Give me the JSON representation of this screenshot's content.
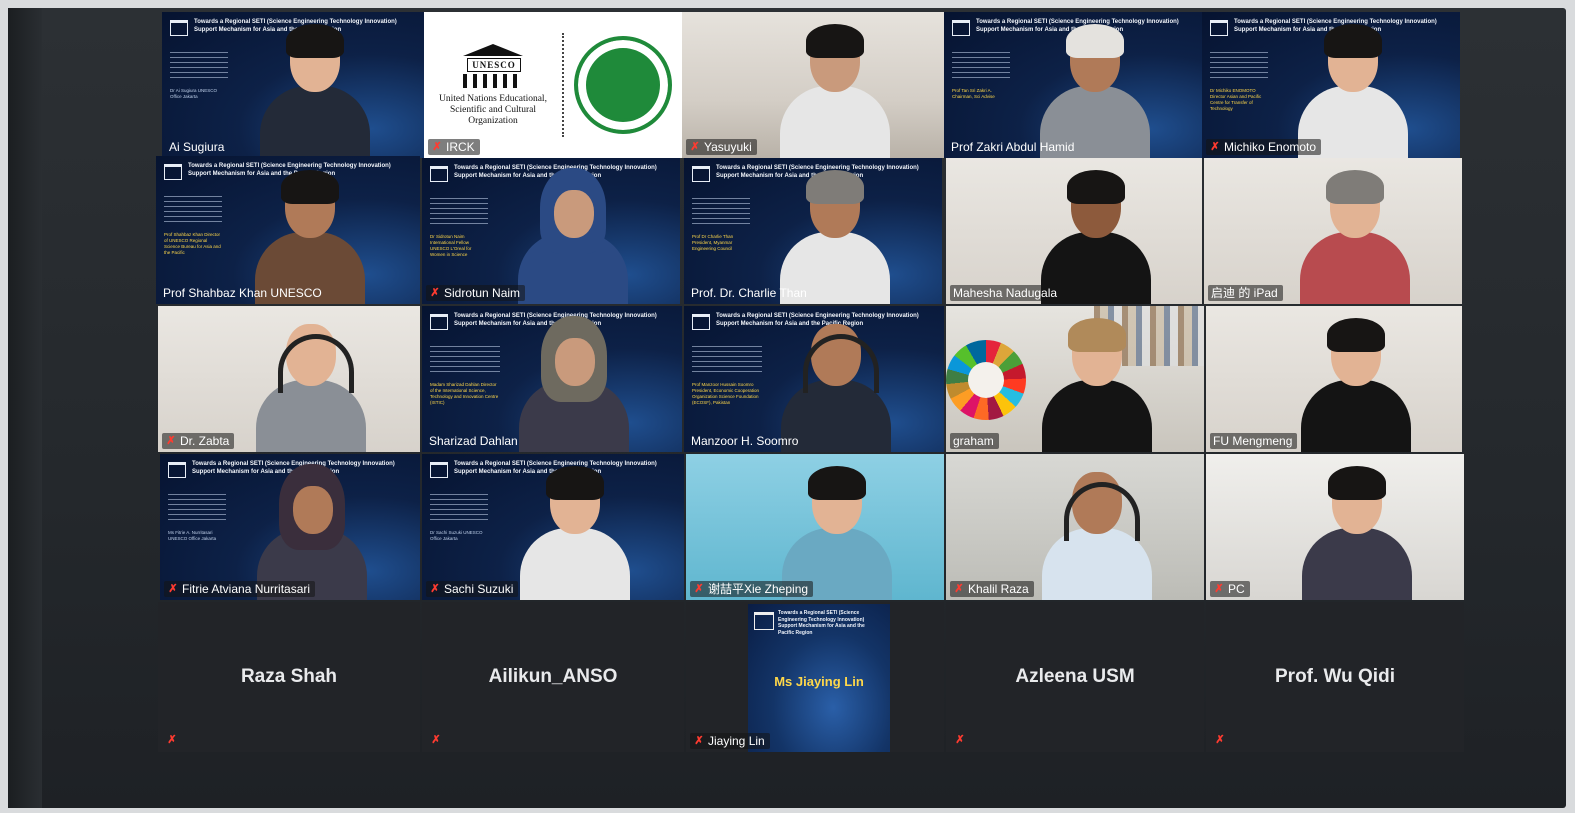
{
  "meeting": {
    "slide_title": "Towards a Regional SETI (Science Engineering Technology Innovation) Support Mechanism for Asia and the Pacific Region",
    "slide_subtitle": "Experts Dialogue on SETI Priorities and Implementation Means Asia Pacific Online Regional Consultation"
  },
  "logos": {
    "unesco_mark": "UNESCO",
    "unesco_text": "United Nations Educational, Scientific and Cultural Organization",
    "irck_text": "INTERNATIONAL RESEARCH CENTER ON KARST IRCK UNESCO"
  },
  "participants": [
    {
      "name": "Ai Sugiura",
      "muted": false,
      "caption": "Dr Ai Sugiura UNESCO Office Jakarta"
    },
    {
      "name": "IRCK",
      "muted": true
    },
    {
      "name": "Yasuyuki",
      "muted": true
    },
    {
      "name": "Prof Zakri Abdul Hamid",
      "muted": false,
      "caption": "Prof Tan Sri Zakri A. Chairman, Sci Advise"
    },
    {
      "name": "Michiko Enomoto",
      "muted": true,
      "caption": "Dr Michiko ENOMOTO Director Asian and Pacific Centre for Transfer of Technology"
    },
    {
      "name": "Prof Shahbaz Khan UNESCO",
      "muted": false,
      "caption": "Prof Shahbaz Khan Director of UNESCO Regional Science Bureau for Asia and the Pacific"
    },
    {
      "name": "Sidrotun Naim",
      "muted": true,
      "caption": "Dr Sidrotun Naim International Fellow UNESCO L'Oreal for Women in Science"
    },
    {
      "name": "Prof. Dr. Charlie Than",
      "muted": false,
      "caption": "Prof Dr Charlie Than President, Myanmar Engineering Council"
    },
    {
      "name": "Mahesha Nadugala",
      "muted": false
    },
    {
      "name": "启迪 的 iPad",
      "muted": false
    },
    {
      "name": "Dr. Zabta",
      "muted": true
    },
    {
      "name": "Sharizad Dahlan",
      "muted": false,
      "caption": "Madam Sharizad Dahlan Director of the International Science, Technology and Innovation Centre (ISTIC)"
    },
    {
      "name": "Manzoor H. Soomro",
      "muted": false,
      "caption": "Prof Manzoor Hussain Soomro President, Economic Cooperation Organization Science Foundation (ECOSF), Pakistan"
    },
    {
      "name": "graham",
      "muted": false
    },
    {
      "name": "FU Mengmeng",
      "muted": false
    },
    {
      "name": "Fitrie Atviana Nurritasari",
      "muted": true,
      "caption": "Ms Fitrie A. Nurritasari UNESCO Office Jakarta"
    },
    {
      "name": "Sachi Suzuki",
      "muted": true,
      "caption": "Dr Sachi Suzuki UNESCO Office Jakarta"
    },
    {
      "name": "谢喆平Xie Zheping",
      "muted": true
    },
    {
      "name": "Khalil Raza",
      "muted": true
    },
    {
      "name": "PC",
      "muted": true
    },
    {
      "name": "Raza Shah",
      "muted": true,
      "video_off": true
    },
    {
      "name": "Ailikun_ANSO",
      "muted": true,
      "video_off": true
    },
    {
      "name": "Jiaying Lin",
      "muted": true,
      "poster_name": "Ms Jiaying Lin"
    },
    {
      "name": "Azleena USM",
      "muted": true,
      "video_off": true
    },
    {
      "name": "Prof. Wu Qidi",
      "muted": true,
      "video_off": true
    }
  ],
  "icons": {
    "mute": "muted-mic-icon"
  },
  "colors": {
    "mute": "#ff3b30",
    "active_speaker": "#d4c58a",
    "slide_bg": "#0d2147"
  }
}
